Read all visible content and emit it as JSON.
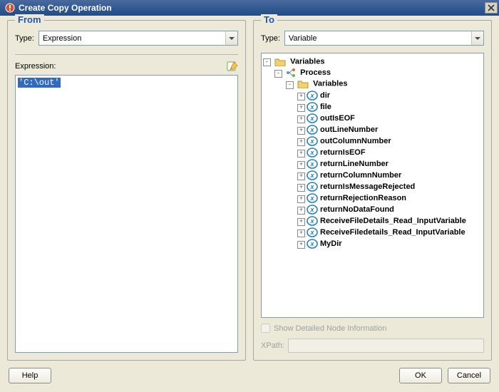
{
  "window": {
    "title": "Create Copy Operation"
  },
  "from": {
    "legend": "From",
    "type_label": "Type:",
    "type_value": "Expression",
    "expression_label": "Expression:",
    "expression_value": "'C:\\out'"
  },
  "to": {
    "legend": "To",
    "type_label": "Type:",
    "type_value": "Variable",
    "tree": {
      "root": {
        "label": "Variables",
        "expander": "-"
      },
      "process": {
        "label": "Process",
        "expander": "-"
      },
      "variables_folder": {
        "label": "Variables",
        "expander": "-"
      },
      "items": [
        {
          "label": "dir"
        },
        {
          "label": "file"
        },
        {
          "label": "outIsEOF"
        },
        {
          "label": "outLineNumber"
        },
        {
          "label": "outColumnNumber"
        },
        {
          "label": "returnIsEOF"
        },
        {
          "label": "returnLineNumber"
        },
        {
          "label": "returnColumnNumber"
        },
        {
          "label": "returnIsMessageRejected"
        },
        {
          "label": "returnRejectionReason"
        },
        {
          "label": "returnNoDataFound"
        },
        {
          "label": "ReceiveFileDetails_Read_InputVariable"
        },
        {
          "label": "ReceiveFiledetails_Read_InputVariable"
        },
        {
          "label": "MyDir"
        }
      ],
      "expander_item": "+"
    },
    "show_detailed_label": "Show Detailed Node Information",
    "xpath_label": "XPath:"
  },
  "buttons": {
    "help": "Help",
    "ok": "OK",
    "cancel": "Cancel"
  }
}
